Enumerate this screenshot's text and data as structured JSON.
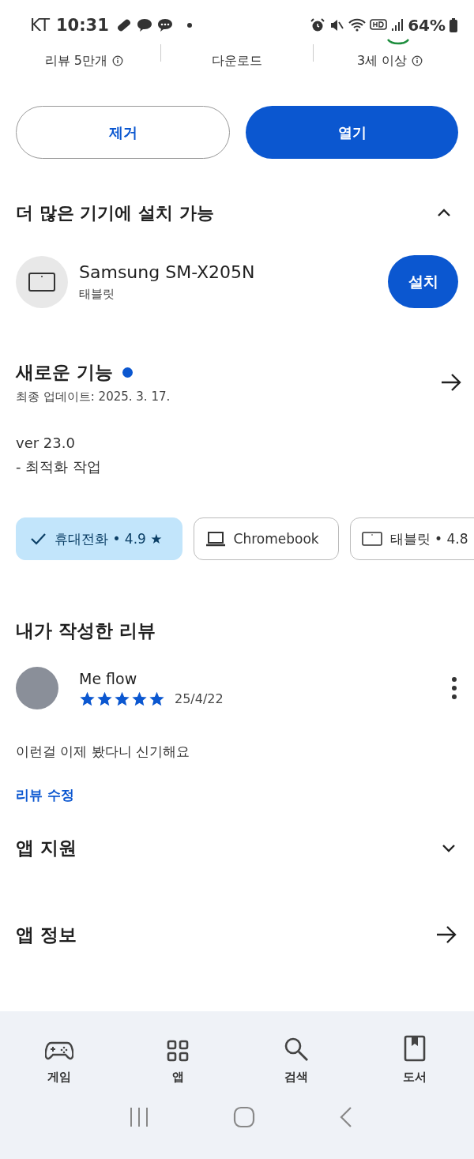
{
  "status_bar": {
    "carrier": "KT",
    "time": "10:31",
    "battery": "64%"
  },
  "stats": [
    {
      "label": "리뷰 5만개",
      "kind": "reviews"
    },
    {
      "label": "다운로드",
      "kind": "downloads"
    },
    {
      "label": "3세 이상",
      "kind": "age"
    }
  ],
  "actions": [
    {
      "label": "제거",
      "kind": "outline"
    },
    {
      "label": "열기",
      "kind": "filled"
    }
  ],
  "devices_section": {
    "title": "더 많은 기기에 설치 가능",
    "expanded": true,
    "devices": [
      {
        "name": "Samsung SM-X205N",
        "type": "태블릿",
        "button": "설치"
      }
    ]
  },
  "whats_new": {
    "title": "새로운 기능",
    "new": true,
    "updated": "최종 업데이트: 2025. 3. 17.",
    "lines": [
      "ver 23.0",
      "- 최적화 작업"
    ]
  },
  "chips": [
    {
      "kind": "phone",
      "label": "휴대전화 • 4.9 ★",
      "selected": true
    },
    {
      "kind": "laptop",
      "label": "Chromebook",
      "selected": false
    },
    {
      "kind": "tablet",
      "label": "태블릿 • 4.8",
      "selected": false
    }
  ],
  "my_review": {
    "title": "내가 작성한 리뷰",
    "author": "Me flow",
    "stars": 5,
    "date": "25/4/22",
    "text": "이런걸 이제 봤다니 신기해요",
    "edit": "리뷰 수정"
  },
  "sections": [
    {
      "title": "앱 지원",
      "kind": "expand"
    },
    {
      "title": "앱 정보",
      "kind": "arrow"
    }
  ],
  "bottom_nav": [
    {
      "kind": "games",
      "label": "게임"
    },
    {
      "kind": "apps",
      "label": "앱"
    },
    {
      "kind": "search",
      "label": "검색"
    },
    {
      "kind": "books",
      "label": "도서"
    }
  ]
}
